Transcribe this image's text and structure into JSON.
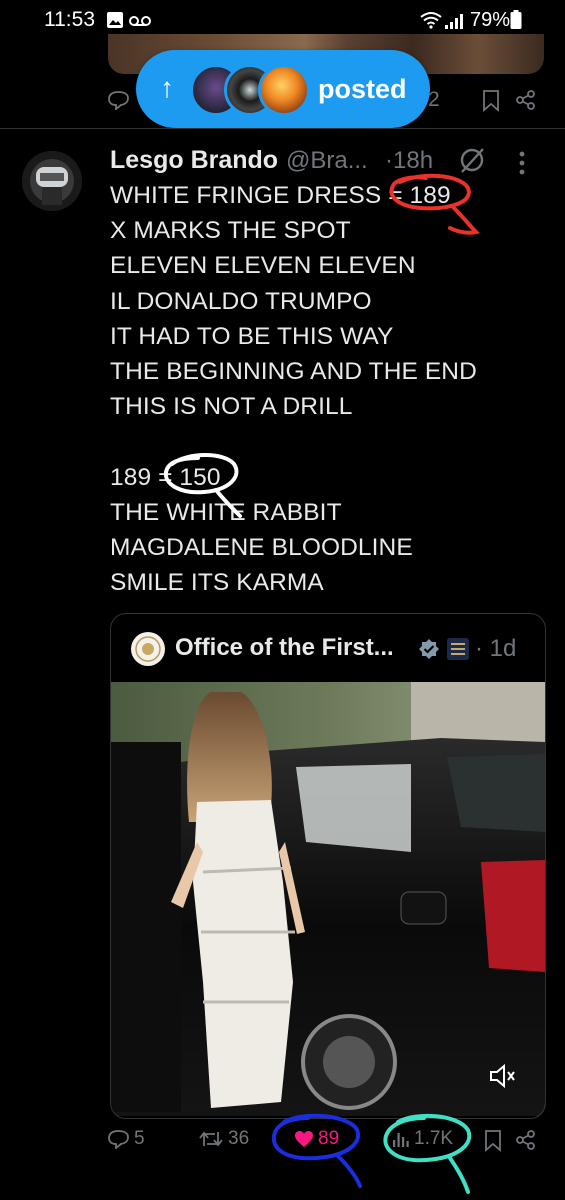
{
  "status_bar": {
    "time": "11:53",
    "battery": "79%",
    "icons": [
      "gallery-icon",
      "voicemail-icon",
      "wifi-icon",
      "signal-icon",
      "battery-icon"
    ]
  },
  "previous_tweet": {
    "count_fragment": "2"
  },
  "posted_pill": {
    "label": "posted",
    "arrow": "↑"
  },
  "tweet": {
    "author_name": "Lesgo Brando",
    "handle": "@Bra...",
    "time_ago": "·18h",
    "lines": [
      "WHITE FRINGE DRESS = 189",
      "X MARKS THE SPOT",
      "ELEVEN ELEVEN ELEVEN",
      "IL DONALDO TRUMPO",
      "IT HAD TO BE THIS WAY",
      "THE BEGINNING AND THE END",
      "THIS IS NOT A DRILL",
      "",
      "189 = 150",
      "THE WHITE RABBIT",
      "MAGDALENE BLOODLINE",
      "SMILE ITS KARMA"
    ],
    "quote": {
      "author_name": "Office of the First...",
      "time_ago": "· 1d"
    },
    "actions": {
      "replies": "5",
      "reposts": "36",
      "likes": "89",
      "views": "1.7K"
    }
  },
  "colors": {
    "accent": "#1d9bf0",
    "like_pink": "#f91880",
    "annot_red": "#e8322a",
    "annot_white": "#ffffff",
    "annot_blue": "#1a2ee0",
    "annot_teal": "#3fe0c5",
    "muted_text": "#71767b"
  }
}
